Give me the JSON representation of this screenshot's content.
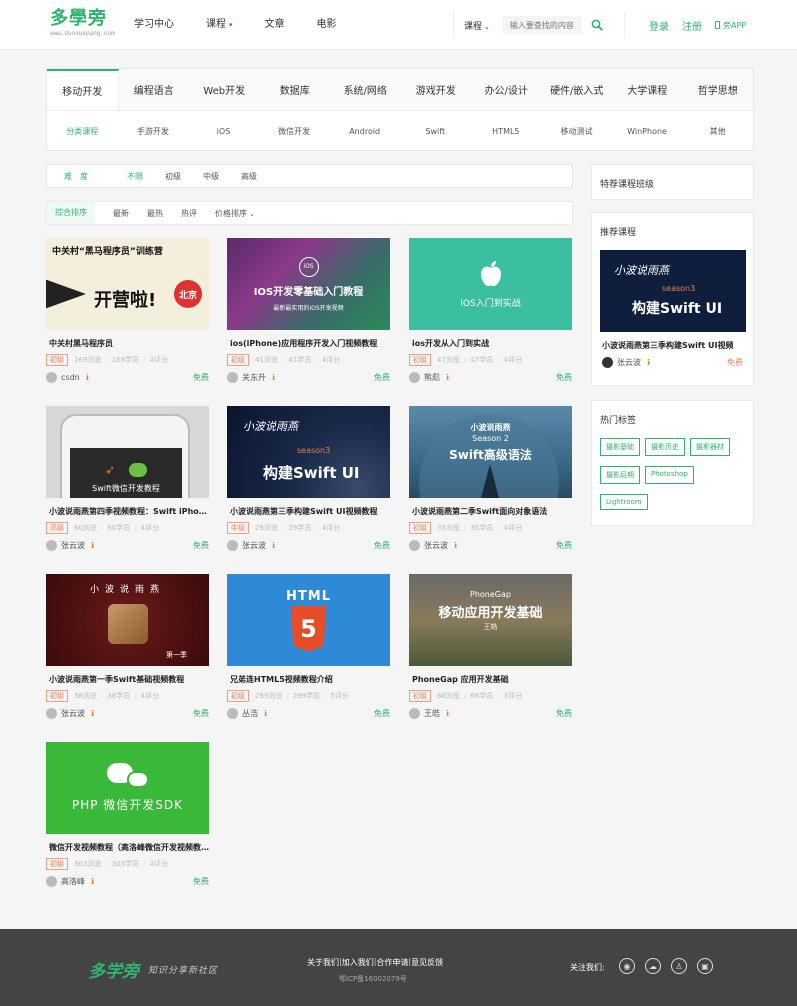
{
  "header": {
    "logo": "多學旁",
    "logo_sub": "www.duoxuepang.com",
    "nav": [
      "学习中心",
      "课程",
      "文章",
      "电影"
    ],
    "search_type": "课程",
    "search_placeholder": "输入要查找的内容",
    "login": "登录",
    "register": "注册",
    "app": "旁APP"
  },
  "categories": {
    "tabs": [
      "移动开发",
      "编程语言",
      "Web开发",
      "数据库",
      "系统/网络",
      "游戏开发",
      "办公/设计",
      "硬件/嵌入式",
      "大学课程",
      "哲学思想"
    ],
    "subs": [
      "分类课程",
      "手游开发",
      "iOS",
      "微信开发",
      "Android",
      "Swift",
      "HTML5",
      "移动测试",
      "WinPhone",
      "其他"
    ]
  },
  "filters": {
    "difficulty_label": "难度",
    "difficulty": [
      "不限",
      "初级",
      "中级",
      "高级"
    ],
    "sort": [
      "综合排序",
      "最新",
      "最热",
      "热评",
      "价格排序"
    ]
  },
  "courses": [
    {
      "title": "中关村黑马程序员",
      "level": "初级",
      "views": "169浏览",
      "students": "169学员",
      "reviews": "4评分",
      "author": "csdn",
      "price": "免费",
      "thumb_text": "中关村“黑马程序员”训练营",
      "thumb_sub": "开营啦!",
      "thumb_badge": "北京"
    },
    {
      "title": "ios(iPhone)应用程序开发入门视频教程",
      "level": "初级",
      "views": "41浏览",
      "students": "41学员",
      "reviews": "4评分",
      "author": "关东升",
      "price": "免费",
      "thumb_text": "IOS开发零基础入门教程",
      "thumb_sub": "最新最实用的IOS开发视频",
      "thumb_badge": "iOS"
    },
    {
      "title": "ios开发从入门到实战",
      "level": "初级",
      "views": "47浏览",
      "students": "47学员",
      "reviews": "4评分",
      "author": "熊彪",
      "price": "免费",
      "thumb_text": "IOS入门到实战"
    },
    {
      "title": "小波说雨燕第四季视频教程：Swift iPhone",
      "level": "高级",
      "views": "60浏览",
      "students": "60学员",
      "reviews": "4评分",
      "author": "张云波",
      "price": "免费",
      "thumb_text": "Swift微信开发教程"
    },
    {
      "title": "小波说雨燕第三季构建Swift UI视频教程",
      "level": "中级",
      "views": "29浏览",
      "students": "29学员",
      "reviews": "4评分",
      "author": "张云波",
      "price": "免费",
      "thumb_text": "构建Swift UI",
      "thumb_sub": "season3",
      "thumb_badge": "小波说雨燕"
    },
    {
      "title": "小波说雨燕第二季Swift面向对象语法",
      "level": "初级",
      "views": "35浏览",
      "students": "35学员",
      "reviews": "4评分",
      "author": "张云波",
      "price": "免费",
      "thumb_text": "Swift高级语法",
      "thumb_sub": "Season 2",
      "thumb_badge": "小波说雨燕"
    },
    {
      "title": "小波说雨燕第一季Swift基础视频教程",
      "level": "初级",
      "views": "38浏览",
      "students": "38学员",
      "reviews": "4评分",
      "author": "张云波",
      "price": "免费",
      "thumb_text": "小波说雨燕",
      "thumb_sub": "第一季"
    },
    {
      "title": "兄弟连HTML5视频教程介绍",
      "level": "初级",
      "views": "299浏览",
      "students": "299学员",
      "reviews": "5评分",
      "author": "丛浩",
      "price": "免费",
      "thumb_text": "HTML",
      "thumb_sub": "5"
    },
    {
      "title": "PhoneGap 应用开发基础",
      "level": "初级",
      "views": "66浏览",
      "students": "66学员",
      "reviews": "3评分",
      "author": "王皓",
      "price": "免费",
      "thumb_text": "移动应用开发基础",
      "thumb_sub": "PhoneGap",
      "thumb_badge": "王皓"
    },
    {
      "title": "微信开发视频教程（高洛峰微信开发视频教程）",
      "level": "初级",
      "views": "303浏览",
      "students": "303学员",
      "reviews": "4评分",
      "author": "高洛峰",
      "price": "免费",
      "thumb_text": "PHP 微信开发SDK"
    }
  ],
  "sidebar": {
    "featured_title": "特荐课程班级",
    "recommend_title": "推荐课程",
    "recommend": {
      "title": "小波说雨燕第三季构建Swift UI视频",
      "author": "张云波",
      "price": "免费",
      "thumb_text": "构建Swift UI",
      "thumb_sub": "season3",
      "thumb_badge": "小波说雨燕"
    },
    "tags_title": "热门标签",
    "tags": [
      "摄影基础",
      "摄影历史",
      "摄影器材",
      "摄影后期",
      "Photoshop",
      "Lightroom"
    ]
  },
  "footer": {
    "logo": "多学旁",
    "slogan": "知识分享新社区",
    "links": [
      "关于我们",
      "加入我们",
      "合作申请",
      "意见反馈"
    ],
    "icp": "鄂ICP备16002079号",
    "follow": "关注我们:"
  },
  "colors": {
    "accent": "#2fb36e",
    "level": "#f08050",
    "footer": "#444444"
  }
}
